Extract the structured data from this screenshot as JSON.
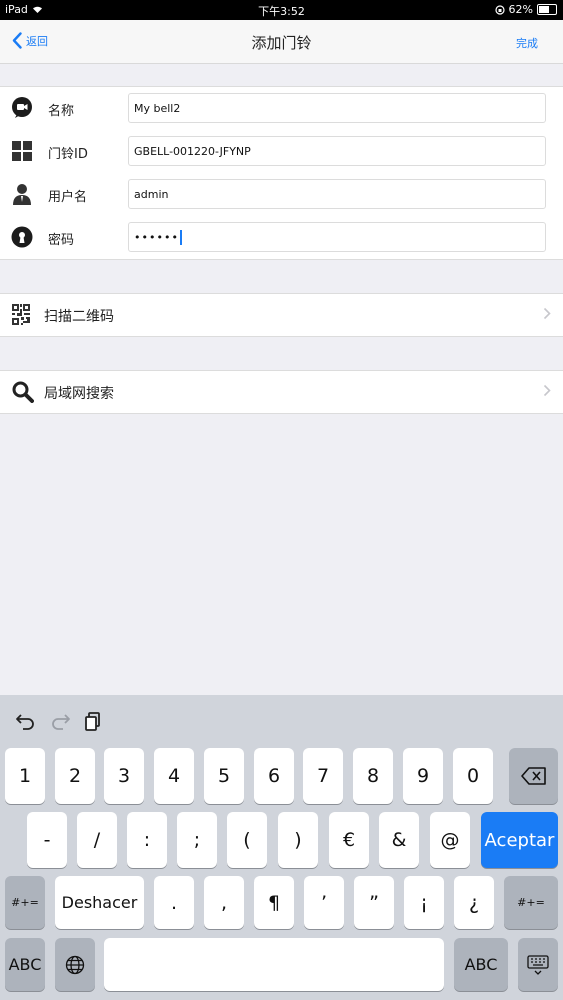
{
  "status_bar": {
    "device": "iPad",
    "time": "下午3:52",
    "battery": "62%"
  },
  "nav": {
    "back_label": "返回",
    "title": "添加门铃",
    "done_label": "完成"
  },
  "form": {
    "name": {
      "label": "名称",
      "value": "My bell2",
      "icon": "chat-bubble-icon"
    },
    "doorbell_id": {
      "label": "门铃ID",
      "value": "GBELL-001220-JFYNP",
      "icon": "grid-icon"
    },
    "username": {
      "label": "用户名",
      "value": "admin",
      "icon": "user-icon"
    },
    "password": {
      "label": "密码",
      "value": "••••••",
      "icon": "keyhole-icon"
    }
  },
  "actions": {
    "scan_qr": {
      "label": "扫描二维码",
      "icon": "qr-code-icon"
    },
    "lan_search": {
      "label": "局域网搜索",
      "icon": "search-icon"
    }
  },
  "keyboard": {
    "row1": [
      "1",
      "2",
      "3",
      "4",
      "5",
      "6",
      "7",
      "8",
      "9",
      "0"
    ],
    "row2": [
      "-",
      "/",
      ":",
      ";",
      "(",
      ")",
      "€",
      "&",
      "@"
    ],
    "accept_label": "Aceptar",
    "row3_left": "#+=",
    "undo_label": "Deshacer",
    "row3_keys": [
      ".",
      ",",
      "¶",
      "’",
      "”",
      "¡",
      "¿"
    ],
    "row3_right": "#+=",
    "abc_label": "ABC"
  }
}
